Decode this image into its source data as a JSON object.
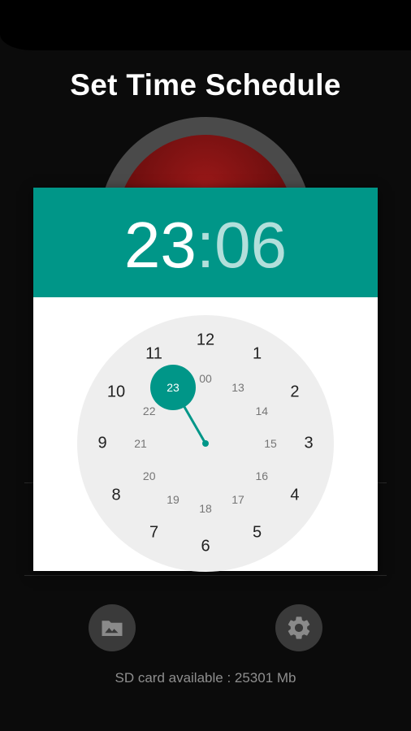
{
  "screen": {
    "title": "Set Time Schedule",
    "sd_status": "SD card available : 25301 Mb"
  },
  "bottom_bar": {
    "gallery_icon": "folder-image-icon",
    "settings_icon": "gear-icon"
  },
  "time_picker": {
    "hours": "23",
    "separator": ":",
    "minutes": "06",
    "selected_hour": "23",
    "outer_hours": [
      "12",
      "1",
      "2",
      "3",
      "4",
      "5",
      "6",
      "7",
      "8",
      "9",
      "10",
      "11"
    ],
    "inner_hours": [
      "00",
      "13",
      "14",
      "15",
      "16",
      "17",
      "18",
      "19",
      "20",
      "21",
      "22",
      "23"
    ]
  },
  "colors": {
    "accent": "#009688",
    "accent_light": "#b2dfdb",
    "clock_face": "#eeeeee",
    "background": "#0b0b0b"
  }
}
